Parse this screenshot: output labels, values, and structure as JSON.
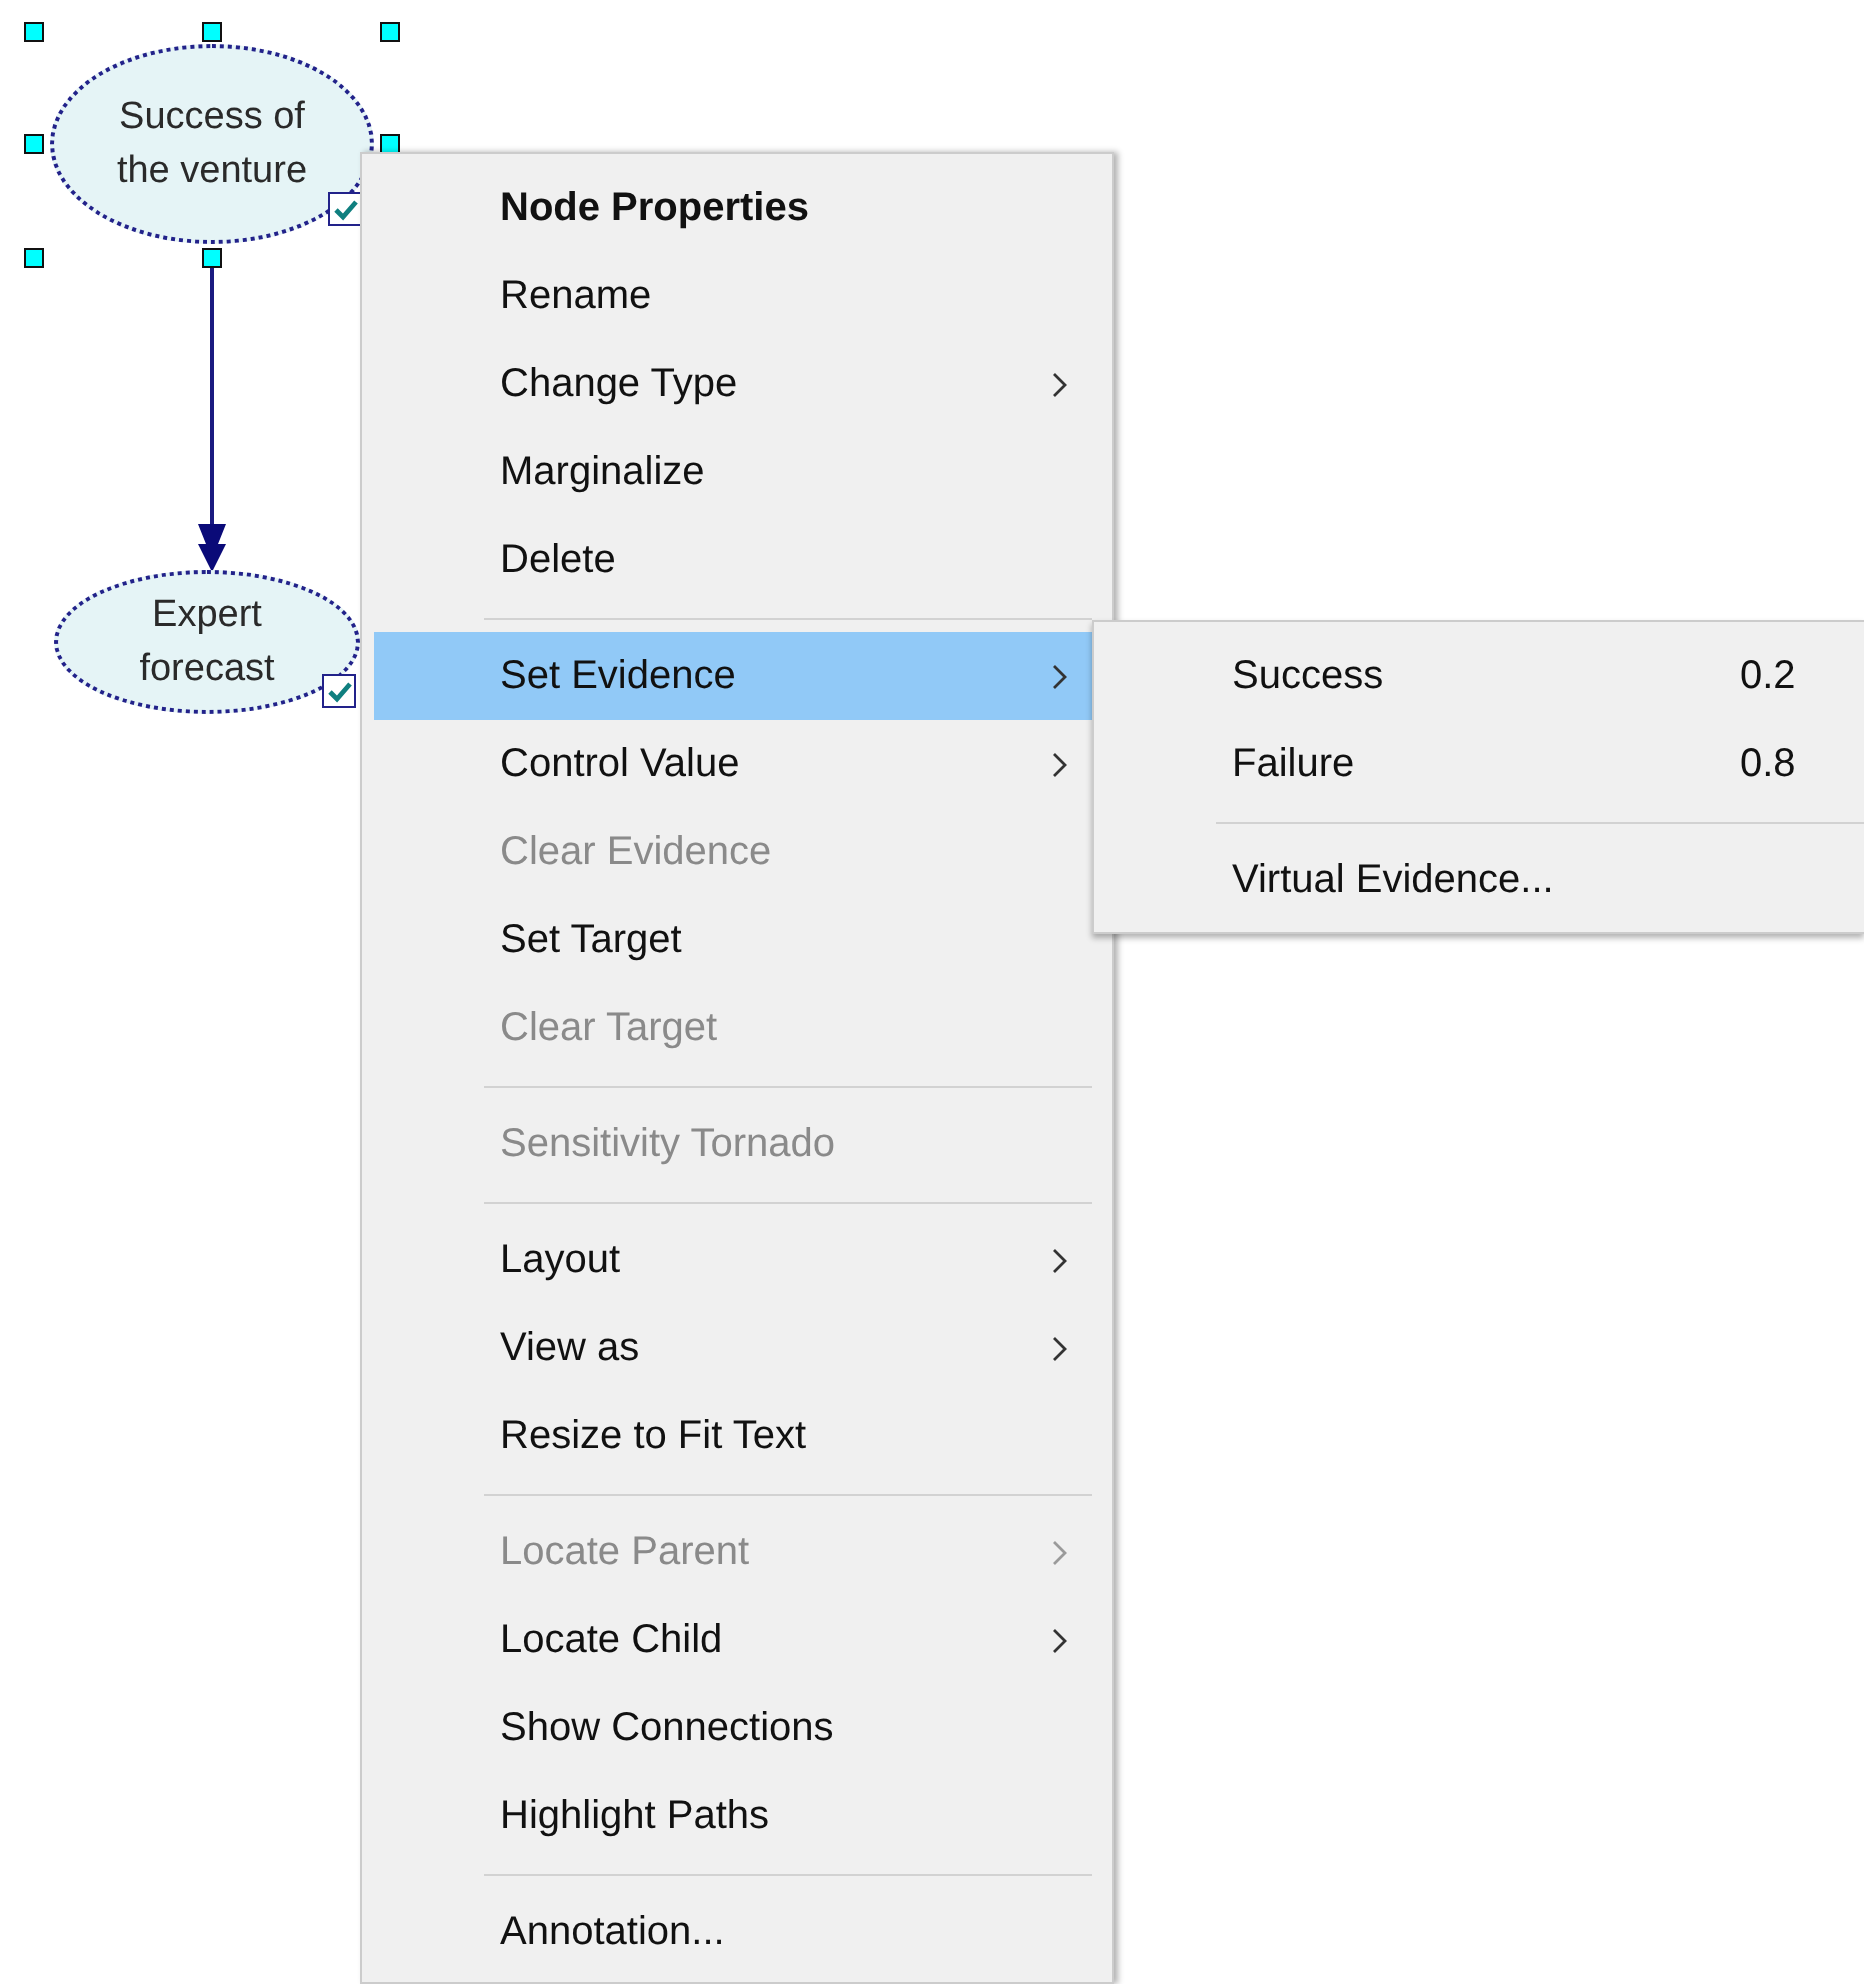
{
  "nodes": [
    {
      "label": "Success of the venture",
      "selected": true,
      "checked": true
    },
    {
      "label": "Expert forecast",
      "selected": false,
      "checked": true
    }
  ],
  "context_menu": {
    "items": [
      {
        "kind": "item",
        "label": "Node Properties",
        "bold": true,
        "disabled": false,
        "submenu": false,
        "selected": false
      },
      {
        "kind": "item",
        "label": "Rename",
        "bold": false,
        "disabled": false,
        "submenu": false,
        "selected": false
      },
      {
        "kind": "item",
        "label": "Change Type",
        "bold": false,
        "disabled": false,
        "submenu": true,
        "selected": false
      },
      {
        "kind": "item",
        "label": "Marginalize",
        "bold": false,
        "disabled": false,
        "submenu": false,
        "selected": false
      },
      {
        "kind": "item",
        "label": "Delete",
        "bold": false,
        "disabled": false,
        "submenu": false,
        "selected": false
      },
      {
        "kind": "separator"
      },
      {
        "kind": "item",
        "label": "Set Evidence",
        "bold": false,
        "disabled": false,
        "submenu": true,
        "selected": true
      },
      {
        "kind": "item",
        "label": "Control Value",
        "bold": false,
        "disabled": false,
        "submenu": true,
        "selected": false
      },
      {
        "kind": "item",
        "label": "Clear Evidence",
        "bold": false,
        "disabled": true,
        "submenu": false,
        "selected": false
      },
      {
        "kind": "item",
        "label": "Set Target",
        "bold": false,
        "disabled": false,
        "submenu": false,
        "selected": false
      },
      {
        "kind": "item",
        "label": "Clear Target",
        "bold": false,
        "disabled": true,
        "submenu": false,
        "selected": false
      },
      {
        "kind": "separator"
      },
      {
        "kind": "item",
        "label": "Sensitivity Tornado",
        "bold": false,
        "disabled": true,
        "submenu": false,
        "selected": false
      },
      {
        "kind": "separator"
      },
      {
        "kind": "item",
        "label": "Layout",
        "bold": false,
        "disabled": false,
        "submenu": true,
        "selected": false
      },
      {
        "kind": "item",
        "label": "View as",
        "bold": false,
        "disabled": false,
        "submenu": true,
        "selected": false
      },
      {
        "kind": "item",
        "label": "Resize to Fit Text",
        "bold": false,
        "disabled": false,
        "submenu": false,
        "selected": false
      },
      {
        "kind": "separator"
      },
      {
        "kind": "item",
        "label": "Locate Parent",
        "bold": false,
        "disabled": true,
        "submenu": true,
        "selected": false
      },
      {
        "kind": "item",
        "label": "Locate Child",
        "bold": false,
        "disabled": false,
        "submenu": true,
        "selected": false
      },
      {
        "kind": "item",
        "label": "Show Connections",
        "bold": false,
        "disabled": false,
        "submenu": false,
        "selected": false
      },
      {
        "kind": "item",
        "label": "Highlight Paths",
        "bold": false,
        "disabled": false,
        "submenu": false,
        "selected": false
      },
      {
        "kind": "separator"
      },
      {
        "kind": "item",
        "label": "Annotation...",
        "bold": false,
        "disabled": false,
        "submenu": false,
        "selected": false
      }
    ]
  },
  "submenu": {
    "items": [
      {
        "kind": "item",
        "label": "Success",
        "value": "0.2"
      },
      {
        "kind": "item",
        "label": "Failure",
        "value": "0.8"
      },
      {
        "kind": "separator"
      },
      {
        "kind": "item",
        "label": "Virtual Evidence..."
      }
    ]
  }
}
